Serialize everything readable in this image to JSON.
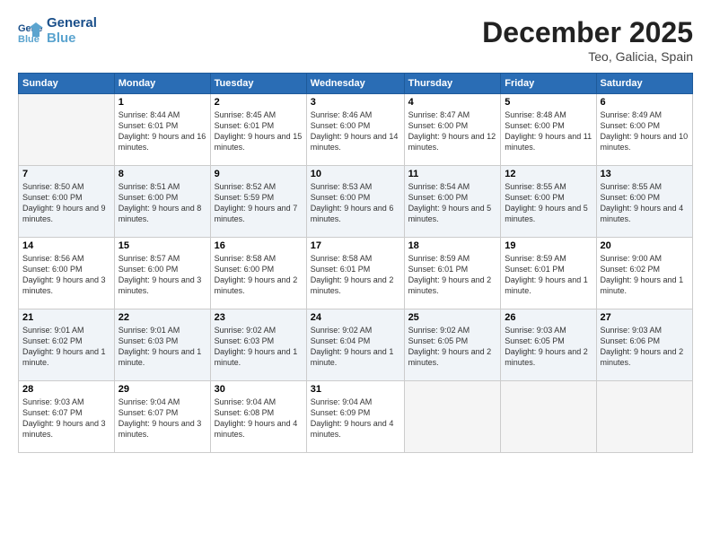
{
  "logo": {
    "line1": "General",
    "line2": "Blue"
  },
  "title": "December 2025",
  "location": "Teo, Galicia, Spain",
  "days_of_week": [
    "Sunday",
    "Monday",
    "Tuesday",
    "Wednesday",
    "Thursday",
    "Friday",
    "Saturday"
  ],
  "weeks": [
    [
      {
        "num": "",
        "sunrise": "",
        "sunset": "",
        "daylight": ""
      },
      {
        "num": "1",
        "sunrise": "Sunrise: 8:44 AM",
        "sunset": "Sunset: 6:01 PM",
        "daylight": "Daylight: 9 hours and 16 minutes."
      },
      {
        "num": "2",
        "sunrise": "Sunrise: 8:45 AM",
        "sunset": "Sunset: 6:01 PM",
        "daylight": "Daylight: 9 hours and 15 minutes."
      },
      {
        "num": "3",
        "sunrise": "Sunrise: 8:46 AM",
        "sunset": "Sunset: 6:00 PM",
        "daylight": "Daylight: 9 hours and 14 minutes."
      },
      {
        "num": "4",
        "sunrise": "Sunrise: 8:47 AM",
        "sunset": "Sunset: 6:00 PM",
        "daylight": "Daylight: 9 hours and 12 minutes."
      },
      {
        "num": "5",
        "sunrise": "Sunrise: 8:48 AM",
        "sunset": "Sunset: 6:00 PM",
        "daylight": "Daylight: 9 hours and 11 minutes."
      },
      {
        "num": "6",
        "sunrise": "Sunrise: 8:49 AM",
        "sunset": "Sunset: 6:00 PM",
        "daylight": "Daylight: 9 hours and 10 minutes."
      }
    ],
    [
      {
        "num": "7",
        "sunrise": "Sunrise: 8:50 AM",
        "sunset": "Sunset: 6:00 PM",
        "daylight": "Daylight: 9 hours and 9 minutes."
      },
      {
        "num": "8",
        "sunrise": "Sunrise: 8:51 AM",
        "sunset": "Sunset: 6:00 PM",
        "daylight": "Daylight: 9 hours and 8 minutes."
      },
      {
        "num": "9",
        "sunrise": "Sunrise: 8:52 AM",
        "sunset": "Sunset: 5:59 PM",
        "daylight": "Daylight: 9 hours and 7 minutes."
      },
      {
        "num": "10",
        "sunrise": "Sunrise: 8:53 AM",
        "sunset": "Sunset: 6:00 PM",
        "daylight": "Daylight: 9 hours and 6 minutes."
      },
      {
        "num": "11",
        "sunrise": "Sunrise: 8:54 AM",
        "sunset": "Sunset: 6:00 PM",
        "daylight": "Daylight: 9 hours and 5 minutes."
      },
      {
        "num": "12",
        "sunrise": "Sunrise: 8:55 AM",
        "sunset": "Sunset: 6:00 PM",
        "daylight": "Daylight: 9 hours and 5 minutes."
      },
      {
        "num": "13",
        "sunrise": "Sunrise: 8:55 AM",
        "sunset": "Sunset: 6:00 PM",
        "daylight": "Daylight: 9 hours and 4 minutes."
      }
    ],
    [
      {
        "num": "14",
        "sunrise": "Sunrise: 8:56 AM",
        "sunset": "Sunset: 6:00 PM",
        "daylight": "Daylight: 9 hours and 3 minutes."
      },
      {
        "num": "15",
        "sunrise": "Sunrise: 8:57 AM",
        "sunset": "Sunset: 6:00 PM",
        "daylight": "Daylight: 9 hours and 3 minutes."
      },
      {
        "num": "16",
        "sunrise": "Sunrise: 8:58 AM",
        "sunset": "Sunset: 6:00 PM",
        "daylight": "Daylight: 9 hours and 2 minutes."
      },
      {
        "num": "17",
        "sunrise": "Sunrise: 8:58 AM",
        "sunset": "Sunset: 6:01 PM",
        "daylight": "Daylight: 9 hours and 2 minutes."
      },
      {
        "num": "18",
        "sunrise": "Sunrise: 8:59 AM",
        "sunset": "Sunset: 6:01 PM",
        "daylight": "Daylight: 9 hours and 2 minutes."
      },
      {
        "num": "19",
        "sunrise": "Sunrise: 8:59 AM",
        "sunset": "Sunset: 6:01 PM",
        "daylight": "Daylight: 9 hours and 1 minute."
      },
      {
        "num": "20",
        "sunrise": "Sunrise: 9:00 AM",
        "sunset": "Sunset: 6:02 PM",
        "daylight": "Daylight: 9 hours and 1 minute."
      }
    ],
    [
      {
        "num": "21",
        "sunrise": "Sunrise: 9:01 AM",
        "sunset": "Sunset: 6:02 PM",
        "daylight": "Daylight: 9 hours and 1 minute."
      },
      {
        "num": "22",
        "sunrise": "Sunrise: 9:01 AM",
        "sunset": "Sunset: 6:03 PM",
        "daylight": "Daylight: 9 hours and 1 minute."
      },
      {
        "num": "23",
        "sunrise": "Sunrise: 9:02 AM",
        "sunset": "Sunset: 6:03 PM",
        "daylight": "Daylight: 9 hours and 1 minute."
      },
      {
        "num": "24",
        "sunrise": "Sunrise: 9:02 AM",
        "sunset": "Sunset: 6:04 PM",
        "daylight": "Daylight: 9 hours and 1 minute."
      },
      {
        "num": "25",
        "sunrise": "Sunrise: 9:02 AM",
        "sunset": "Sunset: 6:05 PM",
        "daylight": "Daylight: 9 hours and 2 minutes."
      },
      {
        "num": "26",
        "sunrise": "Sunrise: 9:03 AM",
        "sunset": "Sunset: 6:05 PM",
        "daylight": "Daylight: 9 hours and 2 minutes."
      },
      {
        "num": "27",
        "sunrise": "Sunrise: 9:03 AM",
        "sunset": "Sunset: 6:06 PM",
        "daylight": "Daylight: 9 hours and 2 minutes."
      }
    ],
    [
      {
        "num": "28",
        "sunrise": "Sunrise: 9:03 AM",
        "sunset": "Sunset: 6:07 PM",
        "daylight": "Daylight: 9 hours and 3 minutes."
      },
      {
        "num": "29",
        "sunrise": "Sunrise: 9:04 AM",
        "sunset": "Sunset: 6:07 PM",
        "daylight": "Daylight: 9 hours and 3 minutes."
      },
      {
        "num": "30",
        "sunrise": "Sunrise: 9:04 AM",
        "sunset": "Sunset: 6:08 PM",
        "daylight": "Daylight: 9 hours and 4 minutes."
      },
      {
        "num": "31",
        "sunrise": "Sunrise: 9:04 AM",
        "sunset": "Sunset: 6:09 PM",
        "daylight": "Daylight: 9 hours and 4 minutes."
      },
      {
        "num": "",
        "sunrise": "",
        "sunset": "",
        "daylight": ""
      },
      {
        "num": "",
        "sunrise": "",
        "sunset": "",
        "daylight": ""
      },
      {
        "num": "",
        "sunrise": "",
        "sunset": "",
        "daylight": ""
      }
    ]
  ]
}
